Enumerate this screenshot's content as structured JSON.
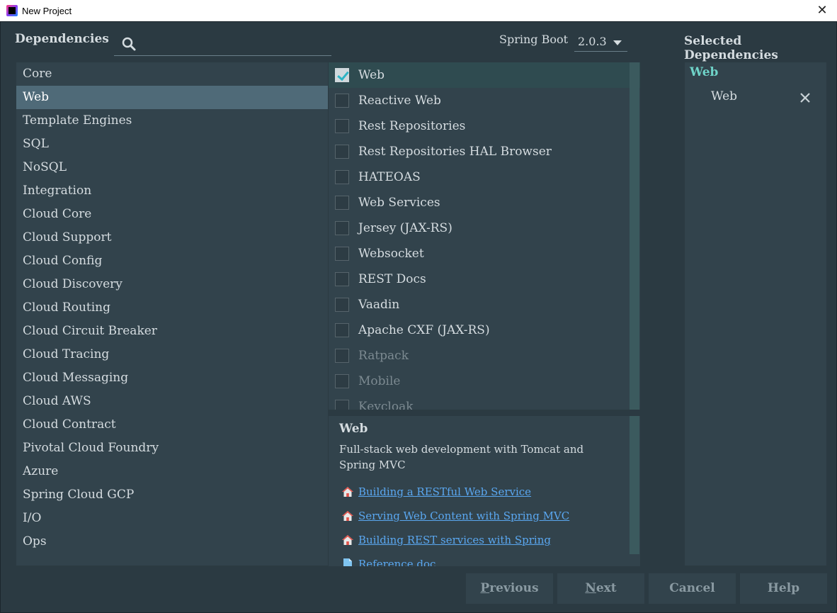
{
  "window": {
    "title": "New Project"
  },
  "header": {
    "dependencies_label": "Dependencies",
    "search_placeholder": "",
    "spring_boot_label": "Spring Boot",
    "spring_boot_version": "2.0.3",
    "selected_label": "Selected Dependencies"
  },
  "categories": [
    {
      "label": "Core"
    },
    {
      "label": "Web",
      "selected": true
    },
    {
      "label": "Template Engines"
    },
    {
      "label": "SQL"
    },
    {
      "label": "NoSQL"
    },
    {
      "label": "Integration"
    },
    {
      "label": "Cloud Core"
    },
    {
      "label": "Cloud Support"
    },
    {
      "label": "Cloud Config"
    },
    {
      "label": "Cloud Discovery"
    },
    {
      "label": "Cloud Routing"
    },
    {
      "label": "Cloud Circuit Breaker"
    },
    {
      "label": "Cloud Tracing"
    },
    {
      "label": "Cloud Messaging"
    },
    {
      "label": "Cloud AWS"
    },
    {
      "label": "Cloud Contract"
    },
    {
      "label": "Pivotal Cloud Foundry"
    },
    {
      "label": "Azure"
    },
    {
      "label": "Spring Cloud GCP"
    },
    {
      "label": "I/O"
    },
    {
      "label": "Ops"
    }
  ],
  "dependencies": [
    {
      "label": "Web",
      "checked": true
    },
    {
      "label": "Reactive Web"
    },
    {
      "label": "Rest Repositories"
    },
    {
      "label": "Rest Repositories HAL Browser"
    },
    {
      "label": "HATEOAS"
    },
    {
      "label": "Web Services"
    },
    {
      "label": "Jersey (JAX-RS)"
    },
    {
      "label": "Websocket"
    },
    {
      "label": "REST Docs"
    },
    {
      "label": "Vaadin"
    },
    {
      "label": "Apache CXF (JAX-RS)"
    },
    {
      "label": "Ratpack",
      "disabled": true
    },
    {
      "label": "Mobile",
      "disabled": true
    },
    {
      "label": "Keycloak",
      "disabled": true
    }
  ],
  "description": {
    "title": "Web",
    "text": "Full-stack web development with Tomcat and Spring MVC",
    "links": [
      {
        "label": "Building a RESTful Web Service",
        "icon": "house-icon"
      },
      {
        "label": "Serving Web Content with Spring MVC",
        "icon": "house-icon"
      },
      {
        "label": "Building REST services with Spring",
        "icon": "house-icon"
      },
      {
        "label": "Reference doc",
        "icon": "document-icon"
      }
    ]
  },
  "selected": {
    "group": "Web",
    "items": [
      {
        "label": "Web"
      }
    ]
  },
  "buttons": {
    "previous_first": "P",
    "previous_rest": "revious",
    "next_first": "N",
    "next_rest": "ext",
    "cancel": "Cancel",
    "help": "Help"
  },
  "colors": {
    "background": "#2b3a42",
    "panel": "#32434c",
    "selected_row": "#4f6a78",
    "link": "#5aa7f0",
    "accent": "#6fd3c8"
  }
}
